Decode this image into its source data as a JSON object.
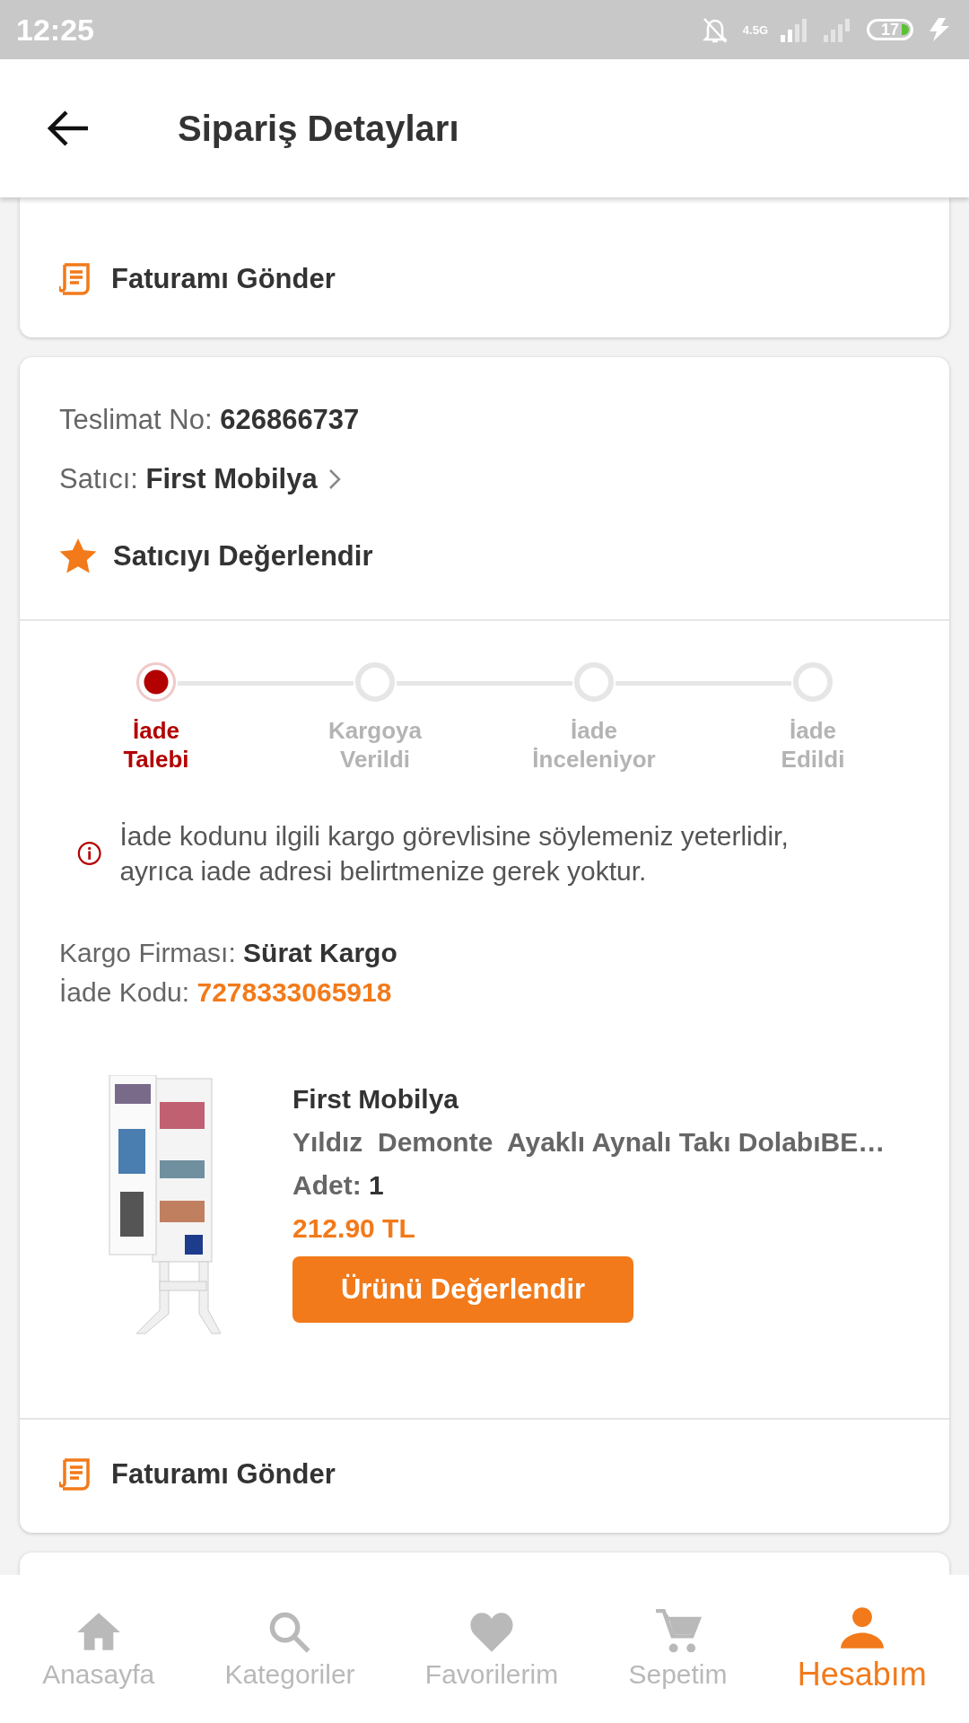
{
  "status_bar": {
    "time": "12:25",
    "network": "4.5G",
    "battery": "17"
  },
  "header": {
    "title": "Sipariş Detayları"
  },
  "top_card": {
    "invoice_action": "Faturamı Gönder"
  },
  "delivery": {
    "delivery_no_label": "Teslimat No:",
    "delivery_no": "626866737",
    "seller_label": "Satıcı:",
    "seller": "First Mobilya",
    "rate_seller": "Satıcıyı Değerlendir",
    "steps": [
      {
        "label": "İade Talebi",
        "active": true
      },
      {
        "label": "Kargoya Verildi",
        "active": false
      },
      {
        "label": "İade İnceleniyor",
        "active": false
      },
      {
        "label": "İade Edildi",
        "active": false
      }
    ],
    "info": "İade kodunu ilgili kargo görevlisine söylemeniz yeterlidir, ayrıca iade adresi belirtmenize gerek yoktur.",
    "carrier_label": "Kargo Firması:",
    "carrier": "Sürat Kargo",
    "return_code_label": "İade Kodu:",
    "return_code": "7278333065918",
    "product": {
      "seller": "First Mobilya",
      "name": "Yıldız  Demonte  Ayaklı Aynalı Takı DolabıBE…",
      "quantity_label": "Adet:",
      "quantity": "1",
      "price": "212.90 TL",
      "rate_button": "Ürünü Değerlendir"
    },
    "invoice_action": "Faturamı Gönder"
  },
  "bottom_nav": [
    {
      "label": "Anasayfa",
      "kind": "home",
      "selected": false
    },
    {
      "label": "Kategoriler",
      "kind": "search",
      "selected": false
    },
    {
      "label": "Favorilerim",
      "kind": "heart",
      "selected": false
    },
    {
      "label": "Sepetim",
      "kind": "cart",
      "selected": false
    },
    {
      "label": "Hesabım",
      "kind": "person",
      "selected": true
    }
  ]
}
